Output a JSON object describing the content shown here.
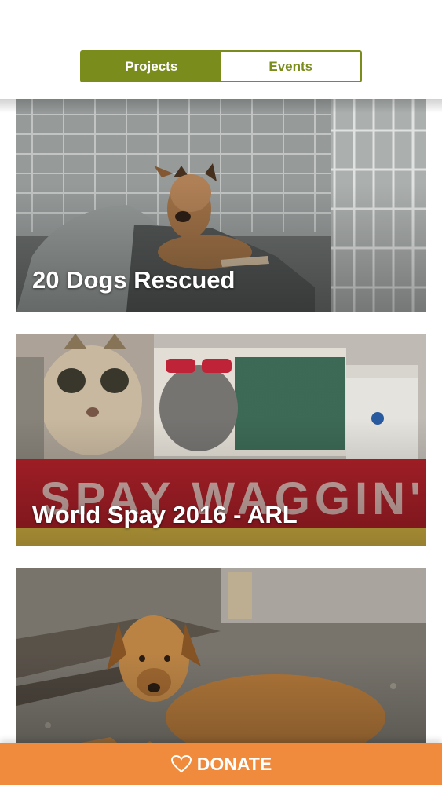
{
  "tabs": {
    "projects_label": "Projects",
    "events_label": "Events",
    "selected": "Projects"
  },
  "projects": [
    {
      "title": "20 Dogs Rescued",
      "image": "dog-in-kennel-photo"
    },
    {
      "title": "World Spay 2016 - ARL",
      "image": "spay-waggin-van-photo"
    },
    {
      "title": "",
      "image": "dog-lying-on-ground-photo"
    }
  ],
  "donate": {
    "label": "DONATE",
    "icon": "heart-outline-icon"
  },
  "colors": {
    "accent_green": "#7a8c1c",
    "donate_orange": "#f08a3c"
  }
}
